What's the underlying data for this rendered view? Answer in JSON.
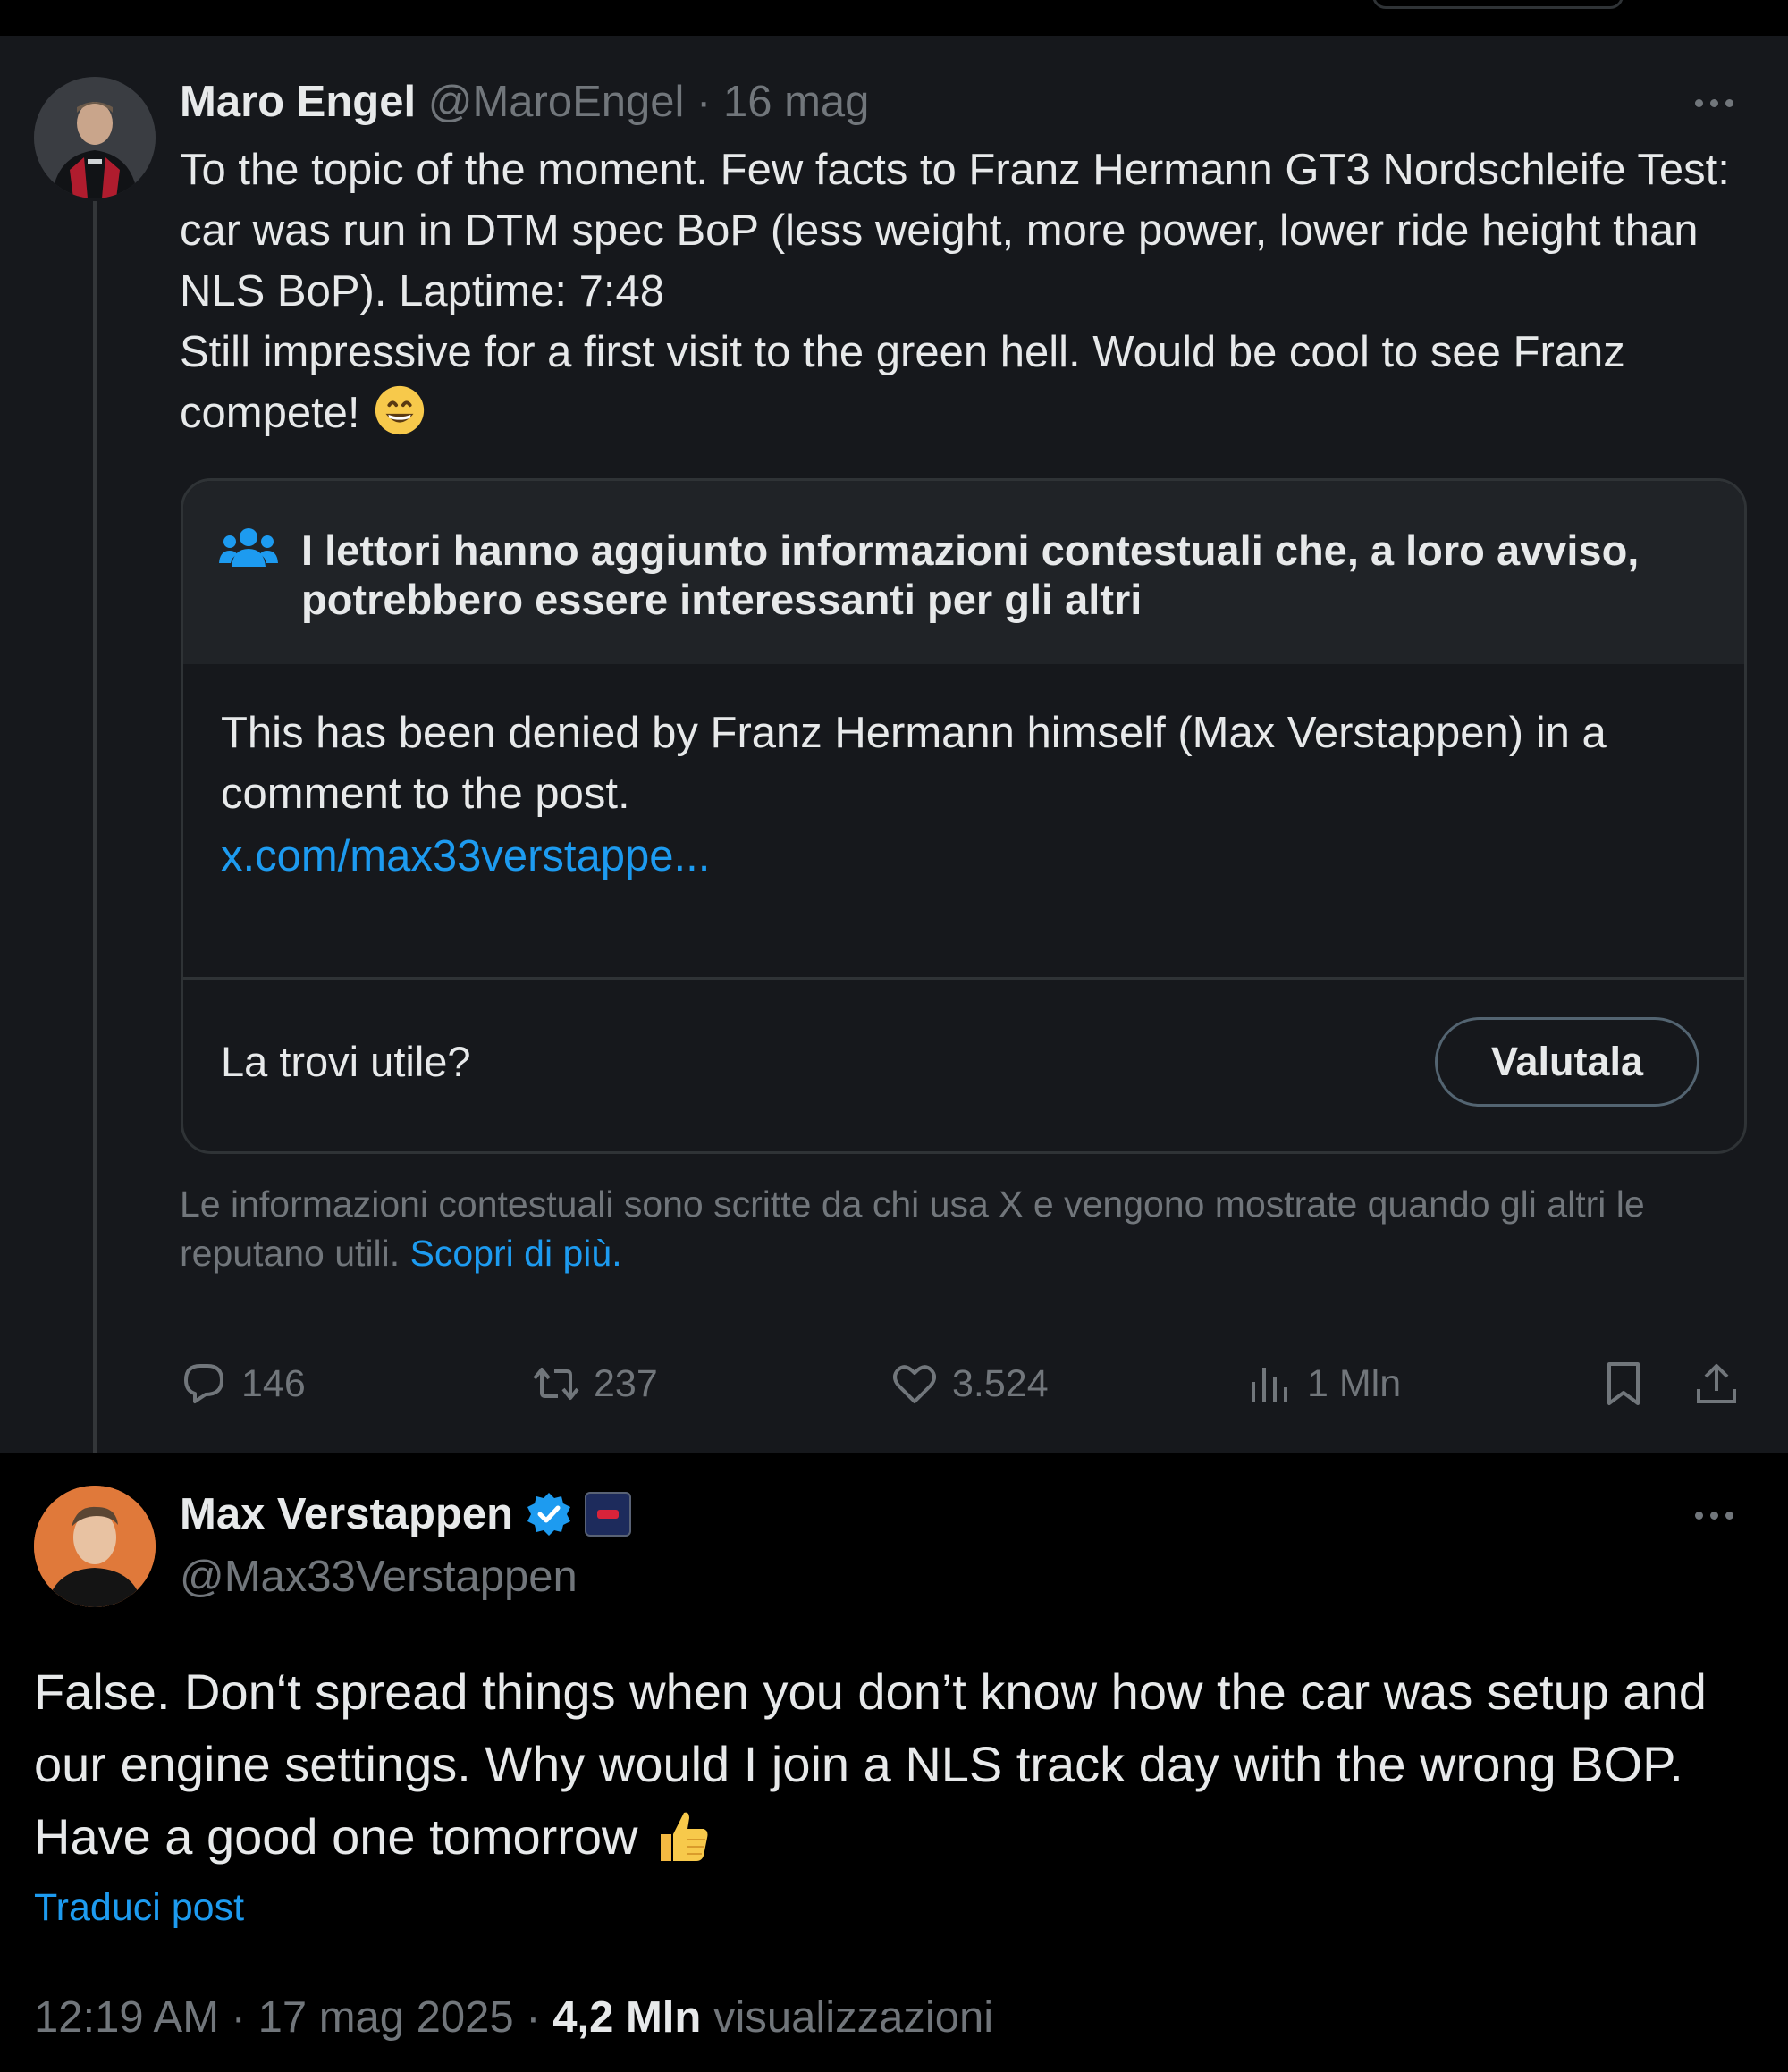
{
  "tweet": {
    "author_name": "Maro Engel",
    "handle": "@MaroEngel",
    "separator": "·",
    "date": "16 mag",
    "text_lines": [
      "To the topic of the moment. Few facts to Franz Hermann GT3 Nordschleife Test: car was run in DTM spec BoP (less weight, more power, lower ride height than NLS BoP). Laptime: 7:48",
      "Still impressive for a first visit to the green hell. Would be cool to see Franz compete!"
    ],
    "emoji": "grinning-face-emoji",
    "community_note": {
      "title": "I lettori hanno aggiunto informazioni contestuali che, a loro avviso, potrebbero essere interessanti per gli altri",
      "text": "This has been denied by Franz Hermann himself (Max Verstappen) in a comment to the post.",
      "link": "x.com/max33verstappe...",
      "question": "La trovi utile?",
      "rate_label": "Valutala"
    },
    "disclaimer": {
      "text": "Le informazioni contestuali sono scritte da chi usa X e vengono mostrate quando gli altri le reputano utili.",
      "link": "Scopri di più",
      "end": "."
    },
    "actions": {
      "replies": "146",
      "reposts": "237",
      "likes": "3.524",
      "views": "1 Mln"
    }
  },
  "reply": {
    "author_name": "Max Verstappen",
    "handle": "@Max33Verstappen",
    "text": "False. Don‘t spread things when you don’t know how the car was setup and our engine settings. Why would I join a NLS track day with the wrong BOP. Have a good one tomorrow",
    "emoji": "thumbs-up-emoji",
    "translate": "Traduci post",
    "time": "12:19 AM",
    "separator": "·",
    "date": "17 mag 2025",
    "views_count": "4,2 Mln",
    "views_label": "visualizzazioni"
  },
  "colors": {
    "background": "#000000",
    "tweet_background": "#16181c",
    "link": "#1d9bf0",
    "muted": "#71767b",
    "text": "#e7e9ea"
  }
}
